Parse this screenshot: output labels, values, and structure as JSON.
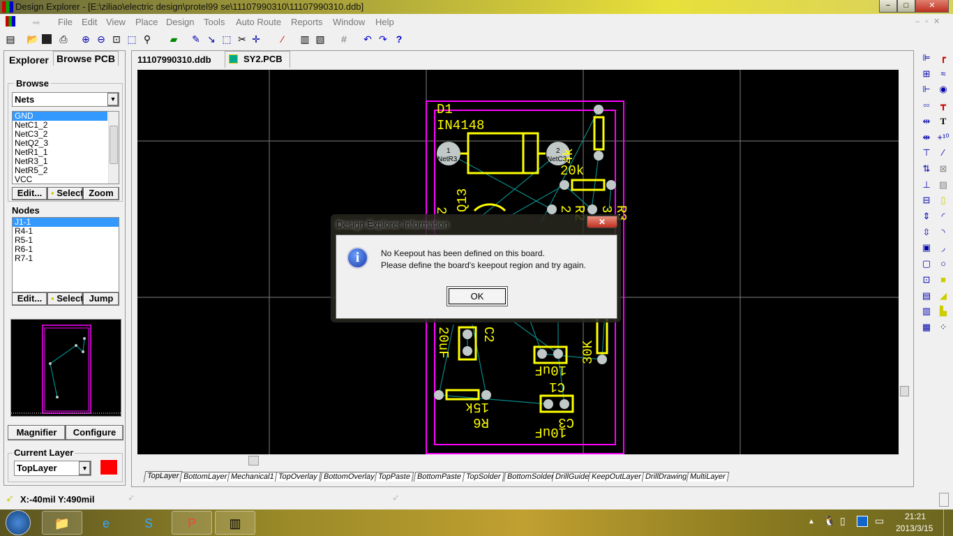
{
  "window": {
    "title": "Design Explorer - [E:\\ziliao\\electric  design\\protel99 se\\11107990310\\11107990310.ddb]",
    "minimize": "−",
    "maximize": "□",
    "close": "✕"
  },
  "menu": [
    "File",
    "Edit",
    "View",
    "Place",
    "Design",
    "Tools",
    "Auto Route",
    "Reports",
    "Window",
    "Help"
  ],
  "toolbar_icons": [
    "tree-icon",
    "open-icon",
    "save-icon",
    "print-icon",
    "zoom-in-icon",
    "zoom-out-icon",
    "zoom-fit-icon",
    "zoom-area-icon",
    "zoom-select-icon",
    "board-icon",
    "route-icon",
    "wire-icon",
    "select-area-icon",
    "deselect-icon",
    "move-icon",
    "wand-icon",
    "library-icon",
    "browse-library-icon",
    "grid-icon",
    "undo-icon",
    "redo-icon",
    "help-icon"
  ],
  "left_panel": {
    "tabs": [
      "Explorer",
      "Browse PCB"
    ],
    "browse_label": "Browse",
    "browse_select": "Nets",
    "nets": [
      "GND",
      "NetC1_2",
      "NetC3_2",
      "NetQ2_3",
      "NetR1_1",
      "NetR3_1",
      "NetR5_2",
      "VCC"
    ],
    "selected_net": "GND",
    "net_buttons": [
      "Edit...",
      "Select",
      "Zoom"
    ],
    "nodes_label": "Nodes",
    "nodes": [
      "J1-1",
      "R4-1",
      "R5-1",
      "R6-1",
      "R7-1"
    ],
    "node_buttons": [
      "Edit...",
      "Select",
      "Jump"
    ],
    "magnifier": "Magnifier",
    "configure": "Configure",
    "current_layer_label": "Current Layer",
    "current_layer": "TopLayer",
    "layer_color": "#ff0000"
  },
  "doc_tabs": [
    "11107990310.ddb",
    "SY2.PCB"
  ],
  "active_doc": "SY2.PCB",
  "pcb": {
    "labels": {
      "d1": "D1",
      "d1_value": "IN4148",
      "pad1": "1",
      "pad2": "2",
      "net1": "NetR3",
      "net2": "NetC3",
      "r_4k": "4k",
      "r_20k": "20k",
      "q": "Q13",
      "c2": "C2",
      "c2_value": "20uF",
      "c1": "C1",
      "c1_value": "10uF",
      "r6": "R6",
      "r6_value": "15k",
      "c3": "C3",
      "c3_value": "10uF",
      "r_30k": "30K",
      "r2": "R2",
      "r3": "R3",
      "n2a": "2",
      "n2b": "2",
      "n3": "3"
    },
    "colors": {
      "board_outline": "#ff00ff",
      "overlay": "#ffff00",
      "pad": "#c0c8c8",
      "ratsnest": "#0a8a8a",
      "grid": "#808080"
    }
  },
  "layers": [
    "TopLayer",
    "BottomLayer",
    "Mechanical1",
    "TopOverlay",
    "BottomOverlay",
    "TopPaste",
    "BottomPaste",
    "TopSolder",
    "BottomSolder",
    "DrillGuide",
    "KeepOutLayer",
    "DrillDrawing",
    "MultiLayer"
  ],
  "active_layer_tab": "TopLayer",
  "status": {
    "coords": "X:-40mil Y:490mil"
  },
  "dialog": {
    "title": "Design Explorer Information",
    "line1": "No Keepout has been defined on this board.",
    "line2": "Please define the board's keepout region and try again.",
    "ok": "OK",
    "close": "✕"
  },
  "taskbar": {
    "time": "21:21",
    "date": "2013/3/15",
    "apps": [
      "explorer",
      "internet-explorer",
      "sogou",
      "powerpoint",
      "protel"
    ]
  }
}
